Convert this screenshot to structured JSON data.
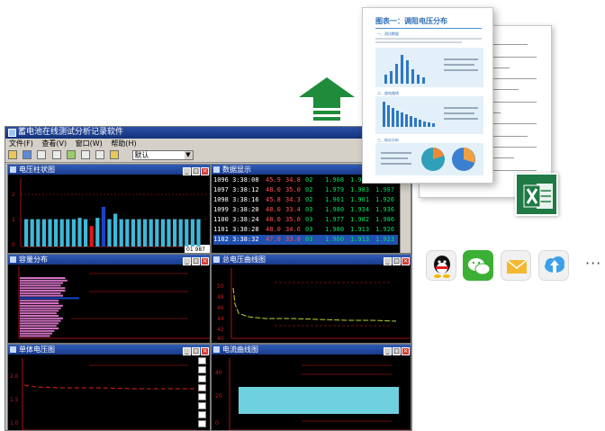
{
  "app": {
    "title": "蓄电池在线测试分析记录软件",
    "menu": [
      "文件(F)",
      "查看(V)",
      "窗口(W)",
      "帮助(H)"
    ],
    "toolbar_combo_value": "默认",
    "toolbar_buttons": [
      "open-icon",
      "save-icon",
      "print-icon",
      "export-icon",
      "chart-icon",
      "table-icon",
      "settings-icon",
      "help-icon"
    ]
  },
  "panels": {
    "voltage_bar": {
      "title": "电压柱状图",
      "y_ticks": [
        "2",
        "1",
        "0"
      ],
      "value_badge": "01 987"
    },
    "data_table": {
      "title": "数据显示",
      "rows": [
        {
          "id": "1096",
          "time": "3:38:08",
          "v1": "45.9",
          "v2": "34.8",
          "st": "02",
          "a": "1.908",
          "b": "1.913",
          "c": ""
        },
        {
          "id": "1097",
          "time": "3:38:12",
          "v1": "48.0",
          "v2": "35.0",
          "st": "02",
          "a": "1.979",
          "b": "1.983",
          "c": "1.987"
        },
        {
          "id": "1098",
          "time": "3:38:16",
          "v1": "45.8",
          "v2": "34.3",
          "st": "02",
          "a": "1.901",
          "b": "1.901",
          "c": "1.926"
        },
        {
          "id": "1099",
          "time": "3:38:20",
          "v1": "48.0",
          "v2": "33.4",
          "st": "03",
          "a": "1.980",
          "b": "1.934",
          "c": "1.936"
        },
        {
          "id": "1100",
          "time": "3:38:24",
          "v1": "48.0",
          "v2": "35.0",
          "st": "03",
          "a": "1.977",
          "b": "1.982",
          "c": "1.986"
        },
        {
          "id": "1101",
          "time": "3:38:28",
          "v1": "48.0",
          "v2": "34.6",
          "st": "03",
          "a": "1.980",
          "b": "1.913",
          "c": "1.926"
        },
        {
          "id": "1102",
          "time": "3:38:32",
          "v1": "47.0",
          "v2": "33.0",
          "st": "03",
          "a": "1.900",
          "b": "1.913",
          "c": "1.923"
        }
      ]
    },
    "capacity": {
      "title": "容量分布"
    },
    "total_voltage": {
      "title": "总电压曲线图",
      "y_ticks": [
        "50",
        "48",
        "46",
        "44",
        "42",
        "40"
      ]
    },
    "single_voltage": {
      "title": "单体电压图",
      "y_ticks": [
        "2.0",
        "1.5",
        "1.0"
      ]
    },
    "current": {
      "title": "电流曲线图",
      "y_ticks": [
        "40",
        "20",
        "0"
      ]
    }
  },
  "report": {
    "title": "图表一：调阻电压分布",
    "sections": [
      "一、测试数据",
      "二、放电曲线",
      "三、结论分析"
    ]
  },
  "share_icons": [
    "qq-icon",
    "wechat-icon",
    "email-icon",
    "cloud-upload-icon"
  ],
  "more_label": "···",
  "colors": {
    "panel_bg": "#000000",
    "bar_cyan": "#3fb8d8",
    "bar_red": "#e01818",
    "bar_blue": "#1844c8",
    "capacity_bar": "#d070c0",
    "excel_green": "#1f7a45",
    "arrow_green": "#1e8c3a"
  }
}
